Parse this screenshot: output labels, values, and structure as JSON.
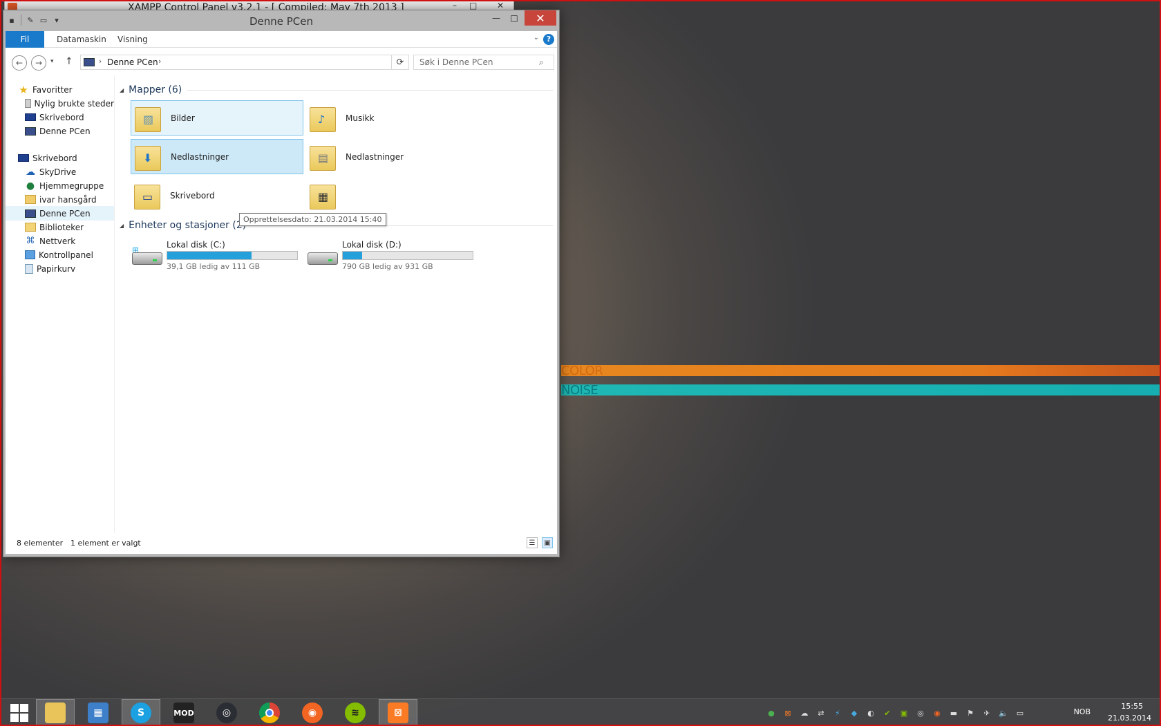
{
  "wallpaper": {
    "stripe1": "COLOR",
    "stripe2": "NOISE"
  },
  "xampp": {
    "title": "XAMPP Control Panel v3.2.1 - [ Compiled: May 7th 2013 ]"
  },
  "window": {
    "title": "Denne PCen"
  },
  "ribbon": {
    "tabs": [
      "Fil",
      "Datamaskin",
      "Visning"
    ],
    "help": "?"
  },
  "address": {
    "location": "Denne PCen",
    "search_placeholder": "Søk i Denne PCen"
  },
  "nav": {
    "items": [
      {
        "label": "Favoritter",
        "icon": "star-icon"
      },
      {
        "label": "Nylig brukte steder",
        "icon": "recent-places-icon"
      },
      {
        "label": "Skrivebord",
        "icon": "desktop-icon"
      },
      {
        "label": "Denne PCen",
        "icon": "computer-icon"
      },
      {
        "label": "Skrivebord",
        "icon": "desktop-icon"
      },
      {
        "label": "SkyDrive",
        "icon": "skydrive-icon"
      },
      {
        "label": "Hjemmegruppe",
        "icon": "homegroup-icon"
      },
      {
        "label": "ivar hansgård",
        "icon": "user-folder-icon"
      },
      {
        "label": "Denne PCen",
        "icon": "computer-icon"
      },
      {
        "label": "Biblioteker",
        "icon": "libraries-icon"
      },
      {
        "label": "Nettverk",
        "icon": "network-icon"
      },
      {
        "label": "Kontrollpanel",
        "icon": "control-panel-icon"
      },
      {
        "label": "Papirkurv",
        "icon": "recycle-bin-icon"
      }
    ]
  },
  "folders_group": {
    "title": "Mapper (6)",
    "items": [
      "Bilder",
      "Musikk",
      "Nedlastninger",
      "Nedlastninger",
      "Skrivebord",
      ""
    ]
  },
  "tooltip": "Opprettelsesdato: 21.03.2014 15:40",
  "drives_group": {
    "title": "Enheter og stasjoner (2)",
    "items": [
      {
        "name": "Lokal disk (C:)",
        "free": "39,1 GB ledig av 111 GB",
        "used_fraction": 0.65
      },
      {
        "name": "Lokal disk (D:)",
        "free": "790 GB ledig av 931 GB",
        "used_fraction": 0.15
      }
    ]
  },
  "status": {
    "count": "8 elementer",
    "selected": "1 element er valgt"
  },
  "tray": {
    "lang": "NOB",
    "time": "15:55",
    "date": "21.03.2014"
  },
  "colors": {
    "accent": "#1979ca",
    "selection": "#cde8f7",
    "progress": "#26a0da",
    "close": "#c7453a"
  }
}
